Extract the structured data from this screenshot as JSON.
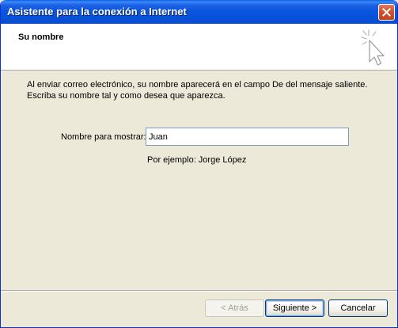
{
  "window": {
    "title": "Asistente para la conexión a Internet"
  },
  "header": {
    "title": "Su nombre"
  },
  "body": {
    "description": "Al enviar correo electrónico, su nombre aparecerá en el campo De del mensaje saliente. Escriba su nombre tal y como desea que aparezca.",
    "field_label": "Nombre para mostrar:",
    "field_value": "Juan",
    "example": "Por ejemplo: Jorge López"
  },
  "buttons": {
    "back": "< Atrás",
    "next": "Siguiente >",
    "cancel": "Cancelar"
  },
  "colors": {
    "titlebar": "#0855dd",
    "dialog_bg": "#ece9d8",
    "close_button": "#d0502c"
  }
}
